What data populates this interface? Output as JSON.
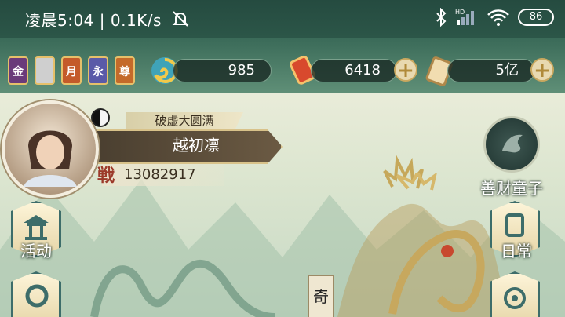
{
  "status_bar": {
    "time_speed": "凌晨5:04 | 0.1K/s",
    "battery": "86",
    "icons": [
      "mute-bell-icon",
      "bluetooth-icon",
      "signal-hd-icon",
      "wifi-icon",
      "battery-icon"
    ]
  },
  "badges": [
    "金",
    "",
    "月",
    "永",
    "尊"
  ],
  "resources": {
    "spirit_jade": "985",
    "red_talisman": "6418",
    "scroll_money": "5亿"
  },
  "player": {
    "realm": "破虚大圆满",
    "name": "越初凛",
    "power_mark": "戦",
    "power": "13082917"
  },
  "side_buttons": {
    "left_top": "活动",
    "left_bottom": "",
    "right_top": "善财童子",
    "right_mid": "日常"
  },
  "scene_tab": "奇"
}
